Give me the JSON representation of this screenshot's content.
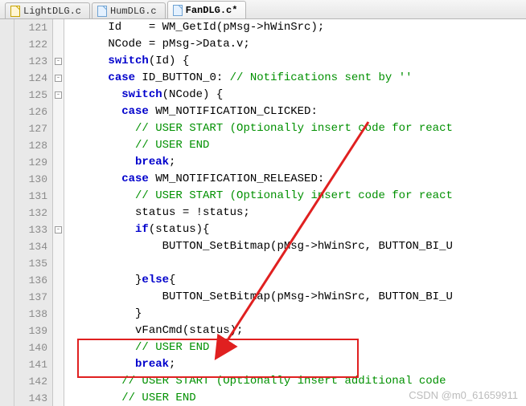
{
  "tabs": [
    {
      "label": "LightDLG.c",
      "active": false
    },
    {
      "label": "HumDLG.c",
      "active": false
    },
    {
      "label": "FanDLG.c*",
      "active": true
    }
  ],
  "fold_marks": {
    "123": "-",
    "124": "-",
    "125": "-",
    "133": "-"
  },
  "code_lines": [
    {
      "n": 121,
      "segs": [
        {
          "t": "      Id    = WM_GetId(pMsg->hWinSrc);"
        }
      ]
    },
    {
      "n": 122,
      "segs": [
        {
          "t": "      NCode = pMsg->Data.v;"
        }
      ]
    },
    {
      "n": 123,
      "segs": [
        {
          "t": "      "
        },
        {
          "t": "switch",
          "c": "kw"
        },
        {
          "t": "(Id) {"
        }
      ]
    },
    {
      "n": 124,
      "segs": [
        {
          "t": "      "
        },
        {
          "t": "case",
          "c": "kw"
        },
        {
          "t": " ID_BUTTON_0: "
        },
        {
          "t": "// Notifications sent by ''",
          "c": "cm"
        }
      ]
    },
    {
      "n": 125,
      "segs": [
        {
          "t": "        "
        },
        {
          "t": "switch",
          "c": "kw"
        },
        {
          "t": "(NCode) {"
        }
      ]
    },
    {
      "n": 126,
      "segs": [
        {
          "t": "        "
        },
        {
          "t": "case",
          "c": "kw"
        },
        {
          "t": " WM_NOTIFICATION_CLICKED:"
        }
      ]
    },
    {
      "n": 127,
      "segs": [
        {
          "t": "          "
        },
        {
          "t": "// USER START (Optionally insert code for react",
          "c": "cm"
        }
      ]
    },
    {
      "n": 128,
      "segs": [
        {
          "t": "          "
        },
        {
          "t": "// USER END",
          "c": "cm"
        }
      ]
    },
    {
      "n": 129,
      "segs": [
        {
          "t": "          "
        },
        {
          "t": "break",
          "c": "kw"
        },
        {
          "t": ";"
        }
      ]
    },
    {
      "n": 130,
      "segs": [
        {
          "t": "        "
        },
        {
          "t": "case",
          "c": "kw"
        },
        {
          "t": " WM_NOTIFICATION_RELEASED:"
        }
      ]
    },
    {
      "n": 131,
      "segs": [
        {
          "t": "          "
        },
        {
          "t": "// USER START (Optionally insert code for react",
          "c": "cm"
        }
      ]
    },
    {
      "n": 132,
      "segs": [
        {
          "t": "          status = !status;"
        }
      ]
    },
    {
      "n": 133,
      "segs": [
        {
          "t": "          "
        },
        {
          "t": "if",
          "c": "kw"
        },
        {
          "t": "(status){"
        }
      ]
    },
    {
      "n": 134,
      "segs": [
        {
          "t": "              BUTTON_SetBitmap(pMsg->hWinSrc, BUTTON_BI_U"
        }
      ]
    },
    {
      "n": 135,
      "segs": [
        {
          "t": " "
        }
      ]
    },
    {
      "n": 136,
      "segs": [
        {
          "t": "          }"
        },
        {
          "t": "else",
          "c": "kw"
        },
        {
          "t": "{"
        }
      ]
    },
    {
      "n": 137,
      "segs": [
        {
          "t": "              BUTTON_SetBitmap(pMsg->hWinSrc, BUTTON_BI_U"
        }
      ]
    },
    {
      "n": 138,
      "segs": [
        {
          "t": "          }"
        }
      ]
    },
    {
      "n": 139,
      "segs": [
        {
          "t": "          vFanCmd(status);"
        }
      ]
    },
    {
      "n": 140,
      "segs": [
        {
          "t": "          "
        },
        {
          "t": "// USER END",
          "c": "cm"
        }
      ]
    },
    {
      "n": 141,
      "segs": [
        {
          "t": "          "
        },
        {
          "t": "break",
          "c": "kw"
        },
        {
          "t": ";"
        }
      ]
    },
    {
      "n": 142,
      "segs": [
        {
          "t": "        "
        },
        {
          "t": "// USER START (Optionally insert additional code",
          "c": "cm"
        }
      ]
    },
    {
      "n": 143,
      "segs": [
        {
          "t": "        "
        },
        {
          "t": "// USER END",
          "c": "cm"
        }
      ]
    }
  ],
  "watermark": "CSDN @m0_61659911"
}
